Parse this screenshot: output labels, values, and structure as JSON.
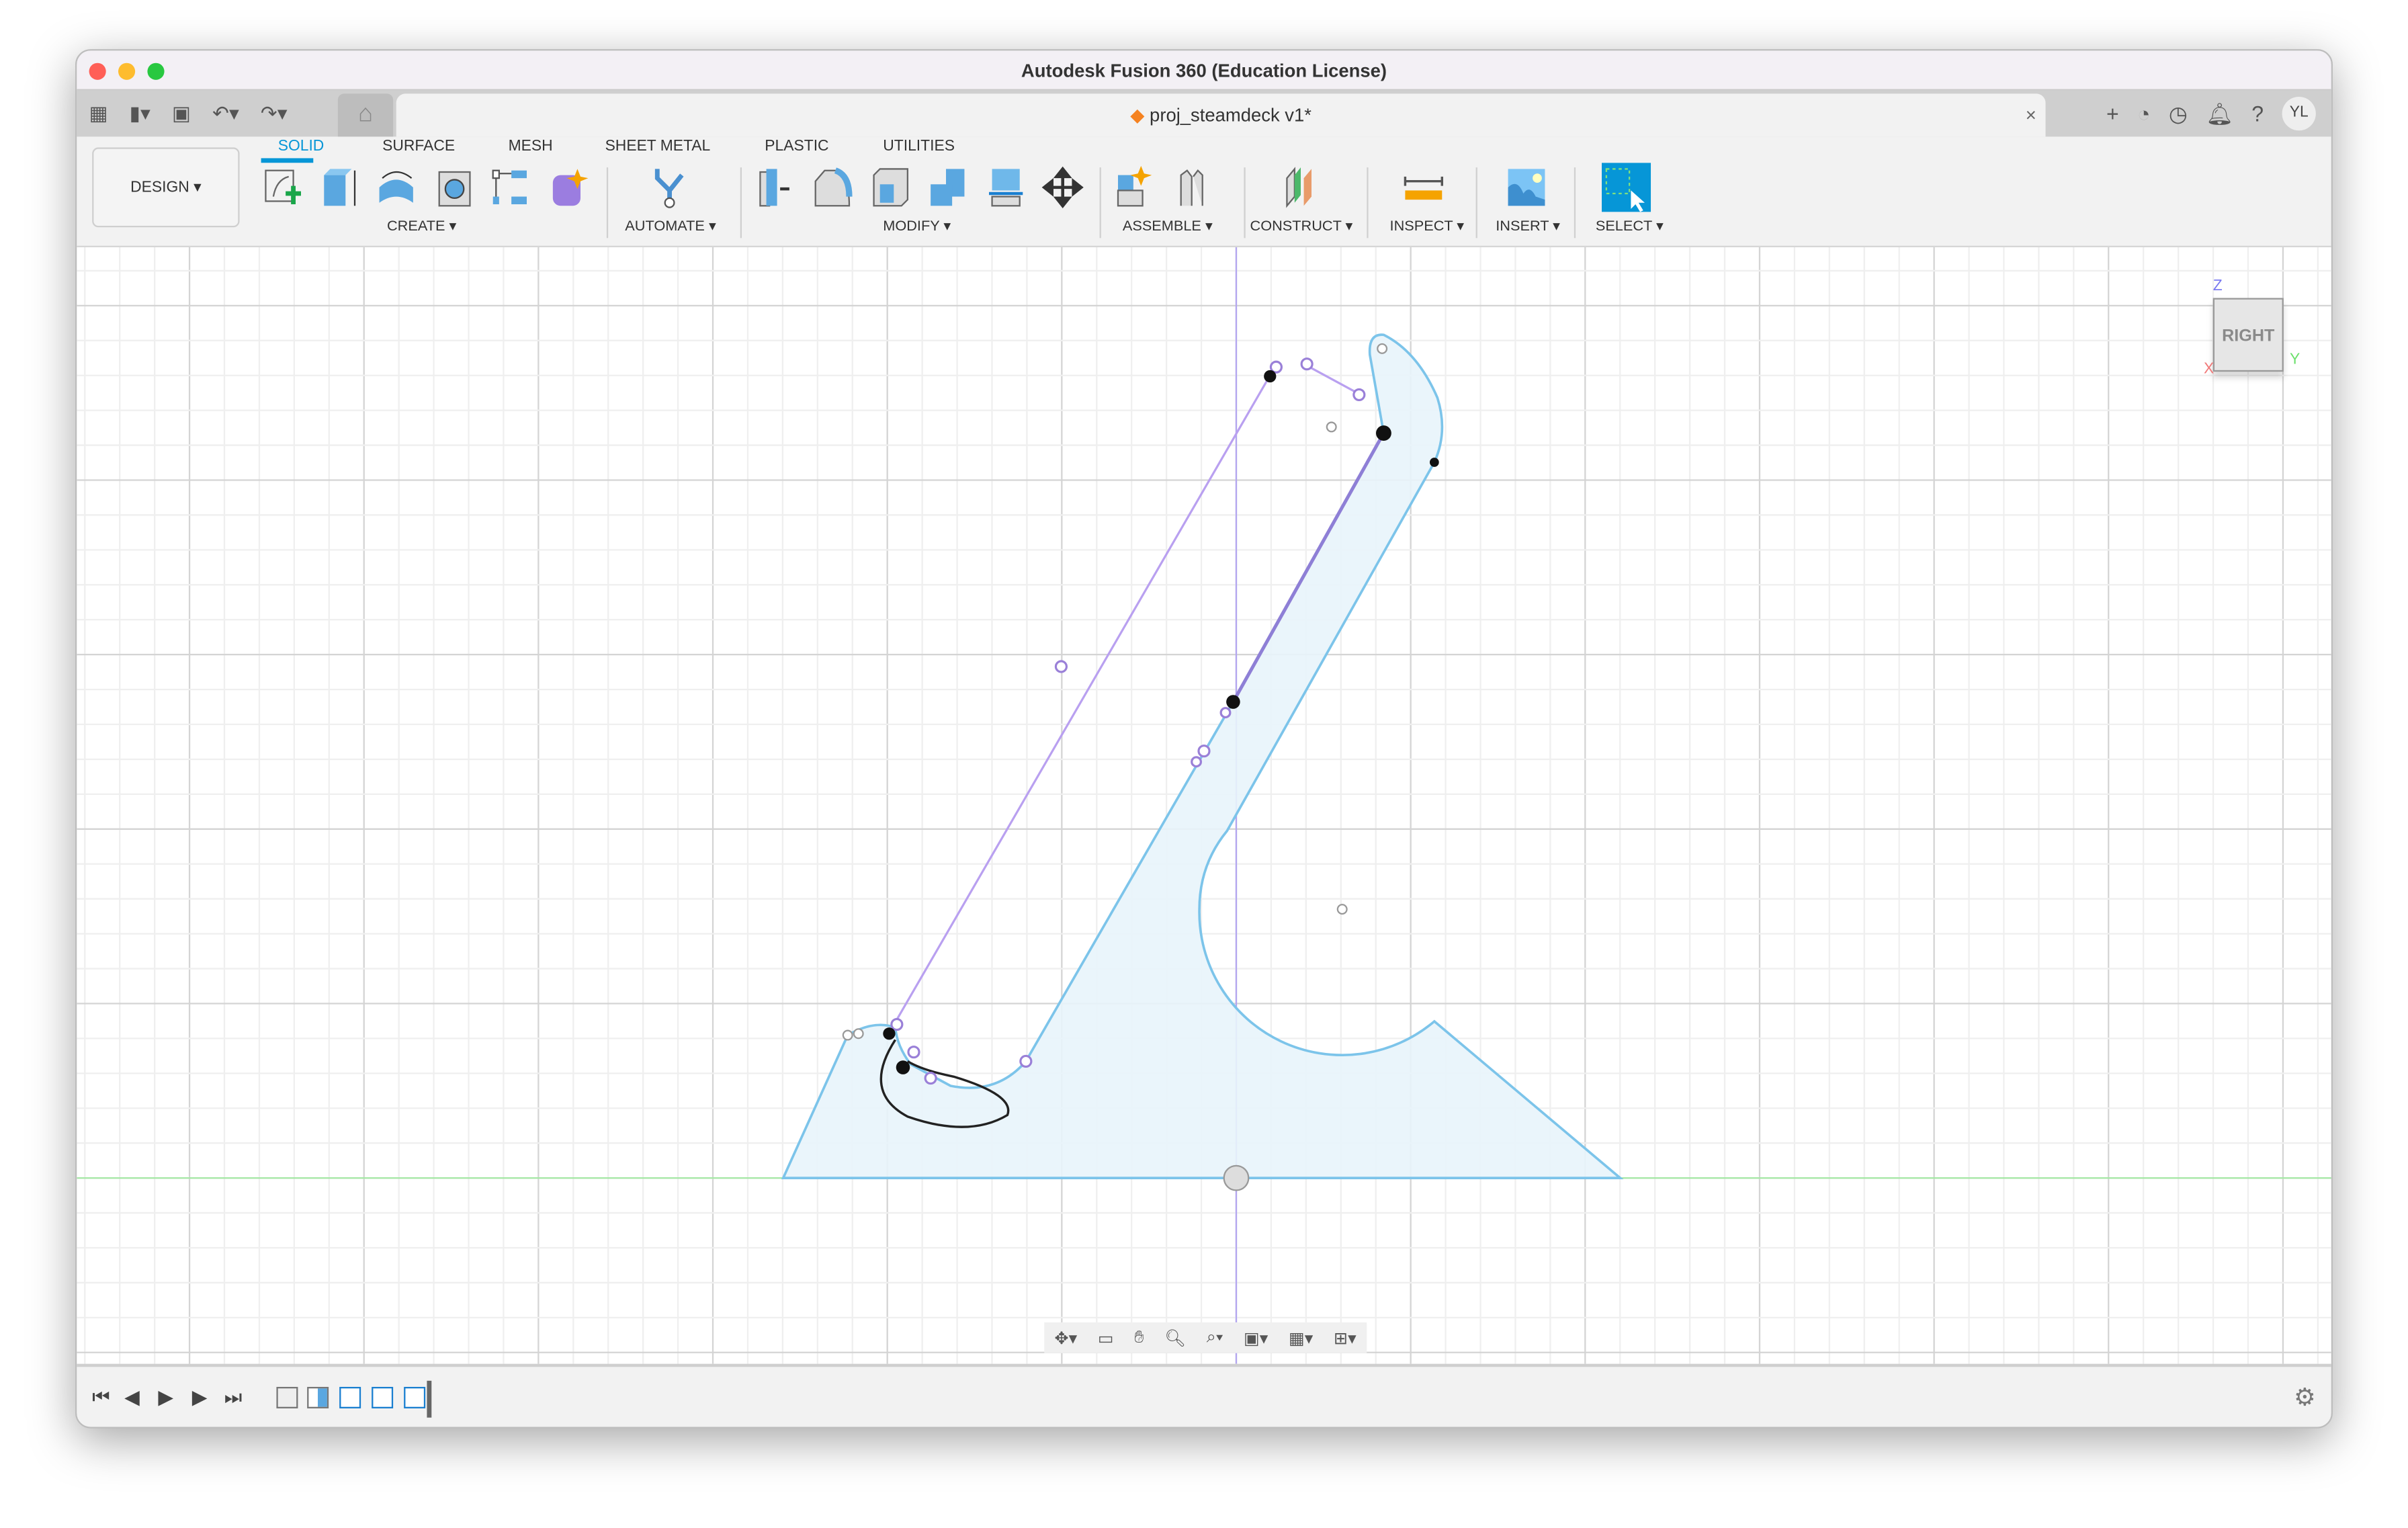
{
  "window": {
    "title": "Autodesk Fusion 360 (Education License)"
  },
  "document_tab": {
    "name": "proj_steamdeck v1*",
    "close": "×"
  },
  "quick_access": {
    "grid": "apps-grid-icon",
    "file": "file-icon",
    "save": "save-icon",
    "undo": "undo-icon",
    "redo": "redo-icon",
    "home": "home-icon"
  },
  "top_right": {
    "add": "+",
    "avatar": "YL"
  },
  "workspace": {
    "label": "DESIGN ▾"
  },
  "tabs": [
    "SOLID",
    "SURFACE",
    "MESH",
    "SHEET METAL",
    "PLASTIC",
    "UTILITIES"
  ],
  "active_tab": "SOLID",
  "groups": {
    "create": "CREATE ▾",
    "automate": "AUTOMATE ▾",
    "modify": "MODIFY ▾",
    "assemble": "ASSEMBLE ▾",
    "construct": "CONSTRUCT ▾",
    "inspect": "INSPECT ▾",
    "insert": "INSERT ▾",
    "select": "SELECT ▾"
  },
  "viewcube": {
    "face": "RIGHT",
    "z": "Z",
    "x": "X",
    "y": "Y"
  },
  "colors": {
    "accent": "#0696d7",
    "sketch_profile": "#7cc4ea",
    "construction": "#b9a0f0",
    "fill": "#e8f4fb"
  },
  "timeline": {
    "controls": [
      "⏮",
      "◀",
      "▶",
      "▶",
      "⏭"
    ],
    "gear": "⚙"
  }
}
